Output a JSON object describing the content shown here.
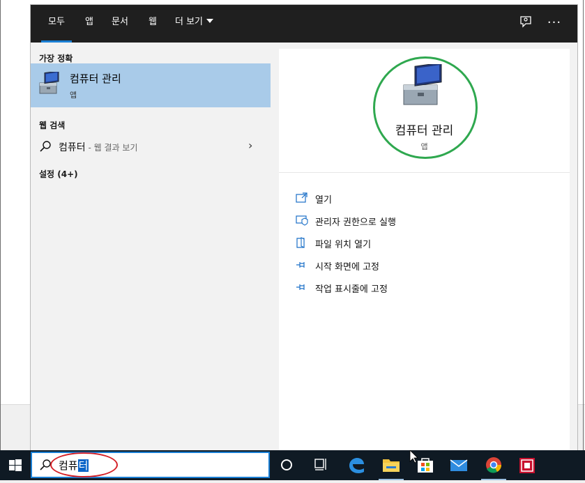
{
  "tabs": [
    "모두",
    "앱",
    "문서",
    "웹",
    "더 보기"
  ],
  "best_match": {
    "section": "가장 정확",
    "name": "컴퓨터 관리",
    "kind": "앱",
    "icon": "computer-management-icon"
  },
  "web_search": {
    "section": "웹 검색",
    "query": "컴퓨터",
    "hint": " - 웹 결과 보기"
  },
  "settings": {
    "section": "설정 (4+)"
  },
  "detail": {
    "title": "컴퓨터 관리",
    "subtitle": "앱",
    "actions": [
      {
        "label": "열기",
        "icon": "open-icon"
      },
      {
        "label": "관리자 권한으로 실행",
        "icon": "run-as-admin-icon"
      },
      {
        "label": "파일 위치 열기",
        "icon": "file-location-icon"
      },
      {
        "label": "시작 화면에 고정",
        "icon": "pin-icon"
      },
      {
        "label": "작업 표시줄에 고정",
        "icon": "pin-icon"
      }
    ]
  },
  "search": {
    "text_before": "컴퓨",
    "text_selected": "터"
  },
  "taskbar": [
    "start-icon",
    "cortana-icon",
    "task-view-icon",
    "edge-icon",
    "file-explorer-icon",
    "store-icon",
    "mail-icon",
    "chrome-icon",
    "app-icon"
  ],
  "colors": {
    "accent": "#1a7fd4",
    "highlight": "#a9cbe9",
    "annotation_green": "#2fa84f",
    "annotation_red": "#d42027"
  }
}
